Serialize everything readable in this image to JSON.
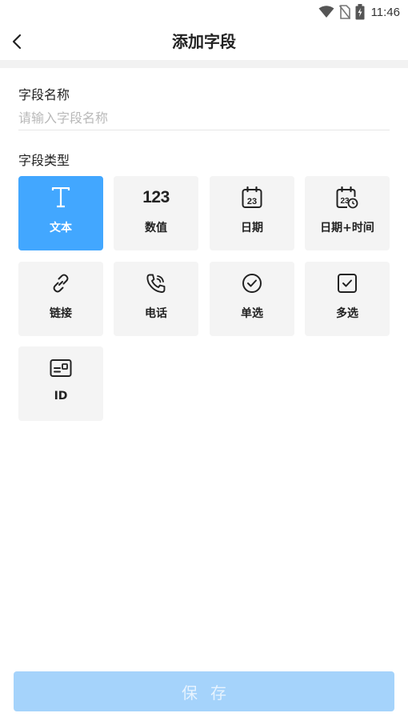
{
  "status_bar": {
    "time": "11:46"
  },
  "header": {
    "title": "添加字段"
  },
  "name_field": {
    "label": "字段名称",
    "placeholder": "请输入字段名称",
    "value": ""
  },
  "type_section": {
    "label": "字段类型",
    "types": [
      {
        "label": "文本",
        "icon": "text-icon",
        "selected": true
      },
      {
        "label": "数值",
        "icon": "number-icon",
        "selected": false
      },
      {
        "label": "日期",
        "icon": "calendar-icon",
        "selected": false
      },
      {
        "label": "日期+时间",
        "icon": "calendar-clock-icon",
        "selected": false
      },
      {
        "label": "链接",
        "icon": "link-icon",
        "selected": false
      },
      {
        "label": "电话",
        "icon": "phone-icon",
        "selected": false
      },
      {
        "label": "单选",
        "icon": "radio-check-icon",
        "selected": false
      },
      {
        "label": "多选",
        "icon": "checkbox-icon",
        "selected": false
      },
      {
        "label": "ID",
        "icon": "id-card-icon",
        "selected": false
      }
    ],
    "icon_text": {
      "number": "123",
      "calendar_day": "23"
    }
  },
  "footer": {
    "save_label": "保存"
  },
  "colors": {
    "accent": "#42a7ff",
    "save_disabled": "#a5d3fb",
    "tile_bg": "#f4f4f4"
  }
}
